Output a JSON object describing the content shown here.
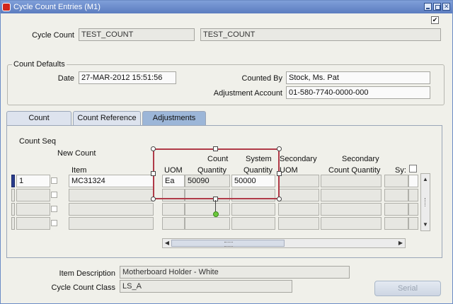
{
  "window": {
    "title": "Cycle Count Entries (M1)"
  },
  "header": {
    "cycle_count_label": "Cycle Count",
    "cycle_count_value": "TEST_COUNT",
    "cycle_count_desc": "TEST_COUNT",
    "check_mark": "✔"
  },
  "defaults": {
    "title": "Count Defaults",
    "date_label": "Date",
    "date_value": "27-MAR-2012 15:51:56",
    "counted_by_label": "Counted By",
    "counted_by_value": "Stock, Ms. Pat",
    "adj_account_label": "Adjustment Account",
    "adj_account_value": "01-580-7740-0000-000"
  },
  "tabs": [
    {
      "label": "Count",
      "active": false
    },
    {
      "label": "Count Reference",
      "active": false
    },
    {
      "label": "Adjustments",
      "active": true
    }
  ],
  "grid": {
    "headers": {
      "count_seq": "Count Seq",
      "new_count": "New Count",
      "item": "Item",
      "uom": "UOM",
      "count_qty_1": "Count",
      "count_qty_2": "Quantity",
      "system_qty_1": "System",
      "system_qty_2": "Quantity",
      "secondary_uom_1": "Secondary",
      "secondary_uom_2": "UOM",
      "secondary_count_1": "Secondary",
      "secondary_count_2": "Count Quantity",
      "sys_truncated": "Sy:"
    },
    "rows": [
      {
        "seq": "1",
        "item": "MC31324",
        "uom": "Ea",
        "count_qty": "50090",
        "system_qty": "50000",
        "sec_uom": "",
        "sec_count": "",
        "sys": ""
      },
      {
        "seq": "",
        "item": "",
        "uom": "",
        "count_qty": "",
        "system_qty": "",
        "sec_uom": "",
        "sec_count": "",
        "sys": ""
      },
      {
        "seq": "",
        "item": "",
        "uom": "",
        "count_qty": "",
        "system_qty": "",
        "sec_uom": "",
        "sec_count": "",
        "sys": ""
      },
      {
        "seq": "",
        "item": "",
        "uom": "",
        "count_qty": "",
        "system_qty": "",
        "sec_uom": "",
        "sec_count": "",
        "sys": ""
      }
    ]
  },
  "footer": {
    "item_desc_label": "Item Description",
    "item_desc_value": "Motherboard Holder - White",
    "class_label": "Cycle Count Class",
    "class_value": "LS_A",
    "serial_button": "Serial"
  },
  "colors": {
    "title_bar": "#5b7cbf",
    "active_tab": "#9cb6d8",
    "highlight": "#fff6b0",
    "selection_rect": "#b03a48"
  }
}
